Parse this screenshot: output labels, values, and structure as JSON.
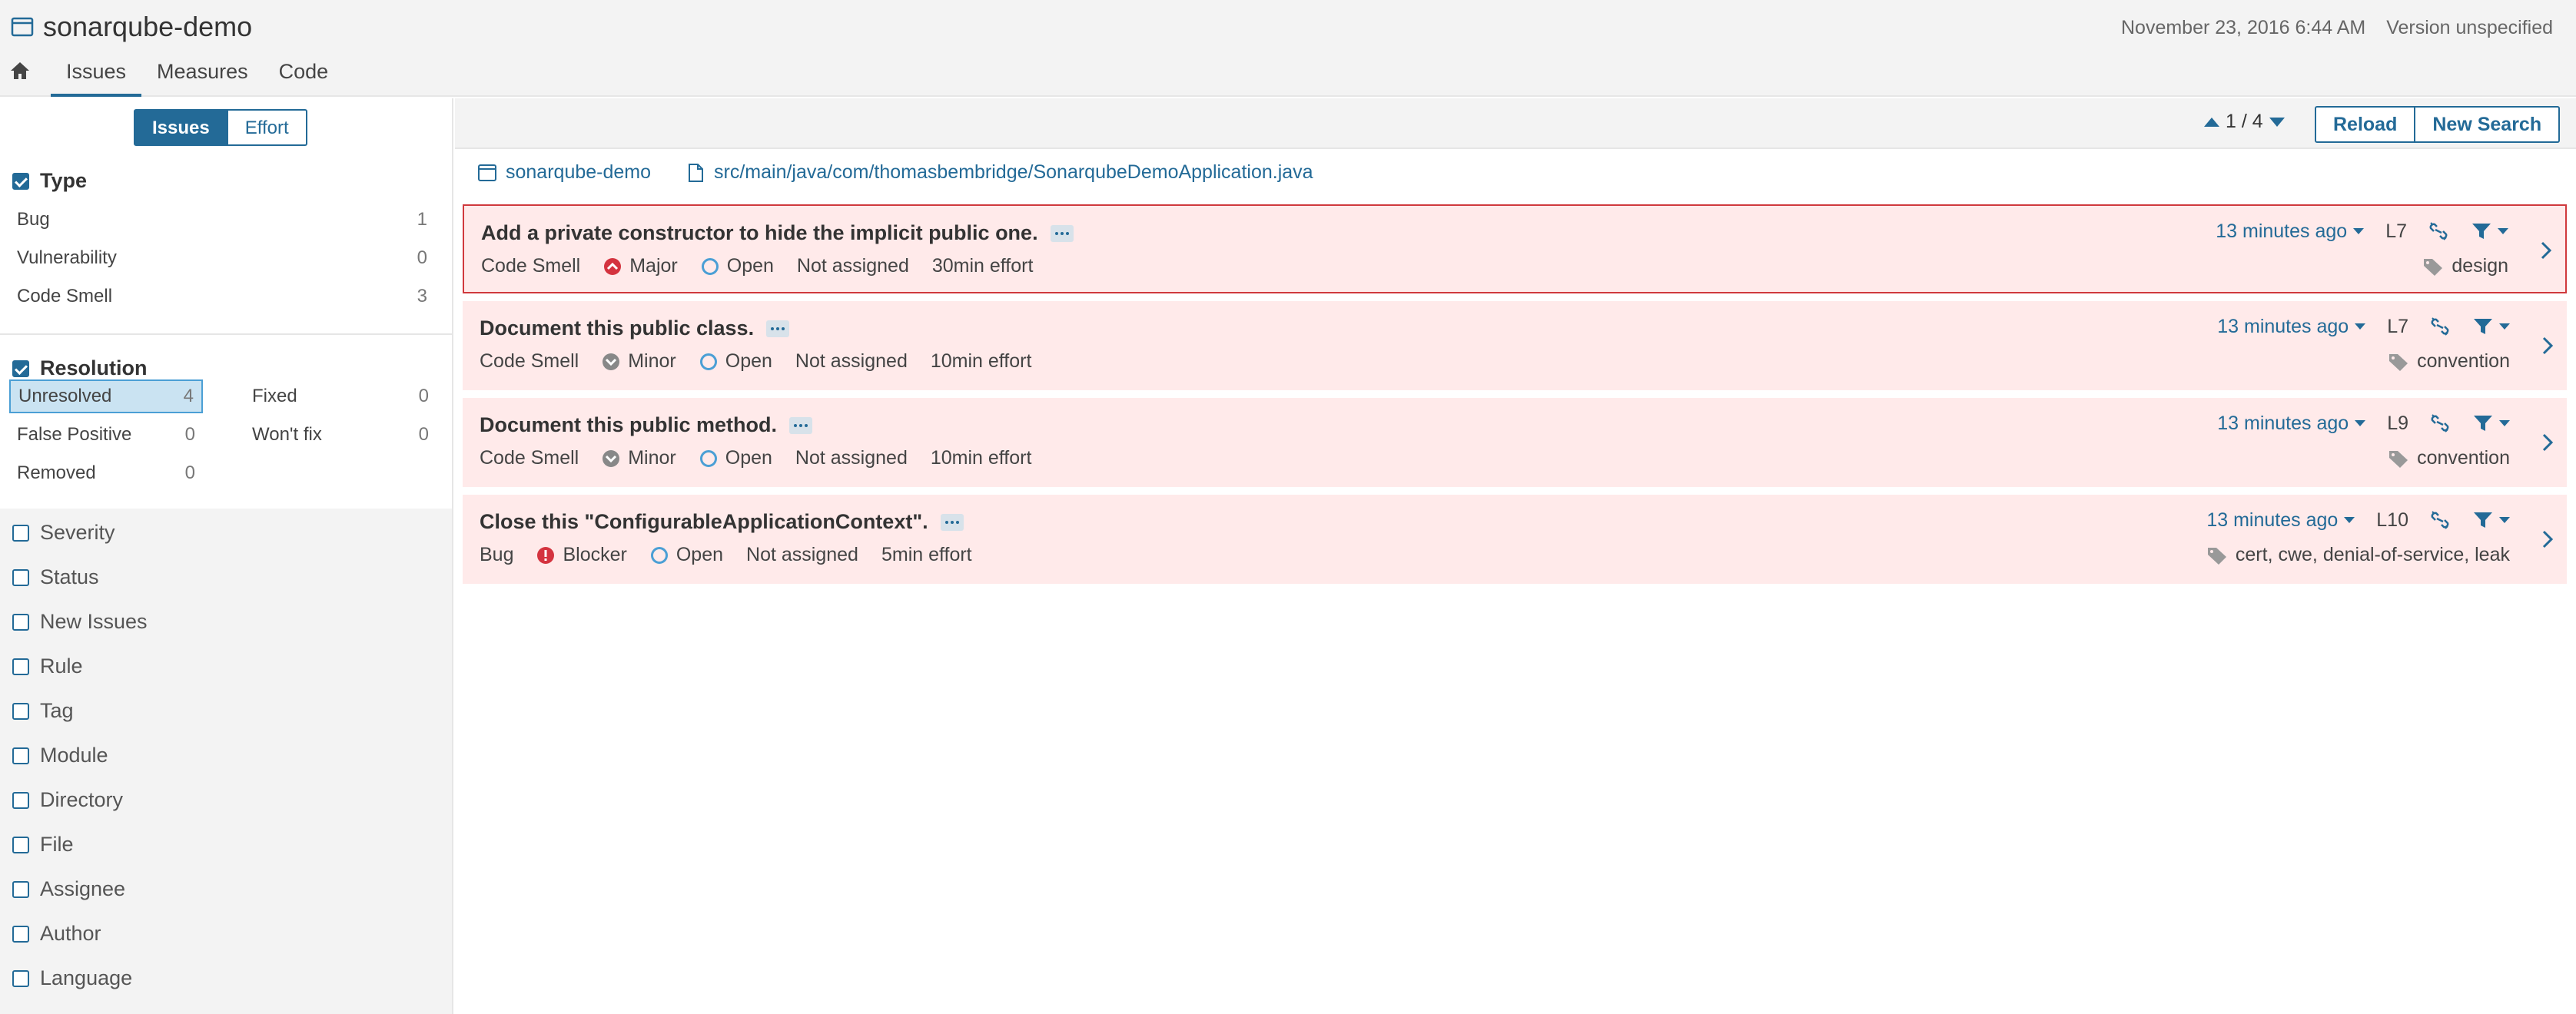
{
  "header": {
    "project": "sonarqube-demo",
    "date": "November 23, 2016 6:44 AM",
    "version": "Version unspecified",
    "tabs": [
      "Issues",
      "Measures",
      "Code"
    ]
  },
  "sidebar": {
    "mode": {
      "issues": "Issues",
      "effort": "Effort"
    },
    "type": {
      "title": "Type",
      "items": [
        {
          "label": "Bug",
          "count": "1"
        },
        {
          "label": "Vulnerability",
          "count": "0"
        },
        {
          "label": "Code Smell",
          "count": "3"
        }
      ]
    },
    "resolution": {
      "title": "Resolution",
      "items": [
        {
          "label": "Unresolved",
          "count": "4"
        },
        {
          "label": "Fixed",
          "count": "0"
        },
        {
          "label": "False Positive",
          "count": "0"
        },
        {
          "label": "Won't fix",
          "count": "0"
        },
        {
          "label": "Removed",
          "count": "0"
        }
      ]
    },
    "facets": [
      "Severity",
      "Status",
      "New Issues",
      "Rule",
      "Tag",
      "Module",
      "Directory",
      "File",
      "Assignee",
      "Author",
      "Language"
    ]
  },
  "toolbar": {
    "pager": "1 / 4",
    "reload": "Reload",
    "new_search": "New Search"
  },
  "breadcrumb": {
    "project": "sonarqube-demo",
    "file": "src/main/java/com/thomasbembridge/SonarqubeDemoApplication.java"
  },
  "issues": [
    {
      "title": "Add a private constructor to hide the implicit public one.",
      "type": "Code Smell",
      "severity": "Major",
      "status": "Open",
      "assignee": "Not assigned",
      "effort": "30min effort",
      "ago": "13 minutes ago",
      "line": "L7",
      "tags": "design"
    },
    {
      "title": "Document this public class.",
      "type": "Code Smell",
      "severity": "Minor",
      "status": "Open",
      "assignee": "Not assigned",
      "effort": "10min effort",
      "ago": "13 minutes ago",
      "line": "L7",
      "tags": "convention"
    },
    {
      "title": "Document this public method.",
      "type": "Code Smell",
      "severity": "Minor",
      "status": "Open",
      "assignee": "Not assigned",
      "effort": "10min effort",
      "ago": "13 minutes ago",
      "line": "L9",
      "tags": "convention"
    },
    {
      "title": "Close this \"ConfigurableApplicationContext\".",
      "type": "Bug",
      "severity": "Blocker",
      "status": "Open",
      "assignee": "Not assigned",
      "effort": "5min effort",
      "ago": "13 minutes ago",
      "line": "L10",
      "tags": "cert, cwe, denial-of-service, leak"
    }
  ],
  "colors": {
    "accent": "#236a97",
    "issue_bg": "#ffeaea",
    "selected_border": "#d0393d",
    "major": "#d4333f",
    "minor": "#888888"
  }
}
